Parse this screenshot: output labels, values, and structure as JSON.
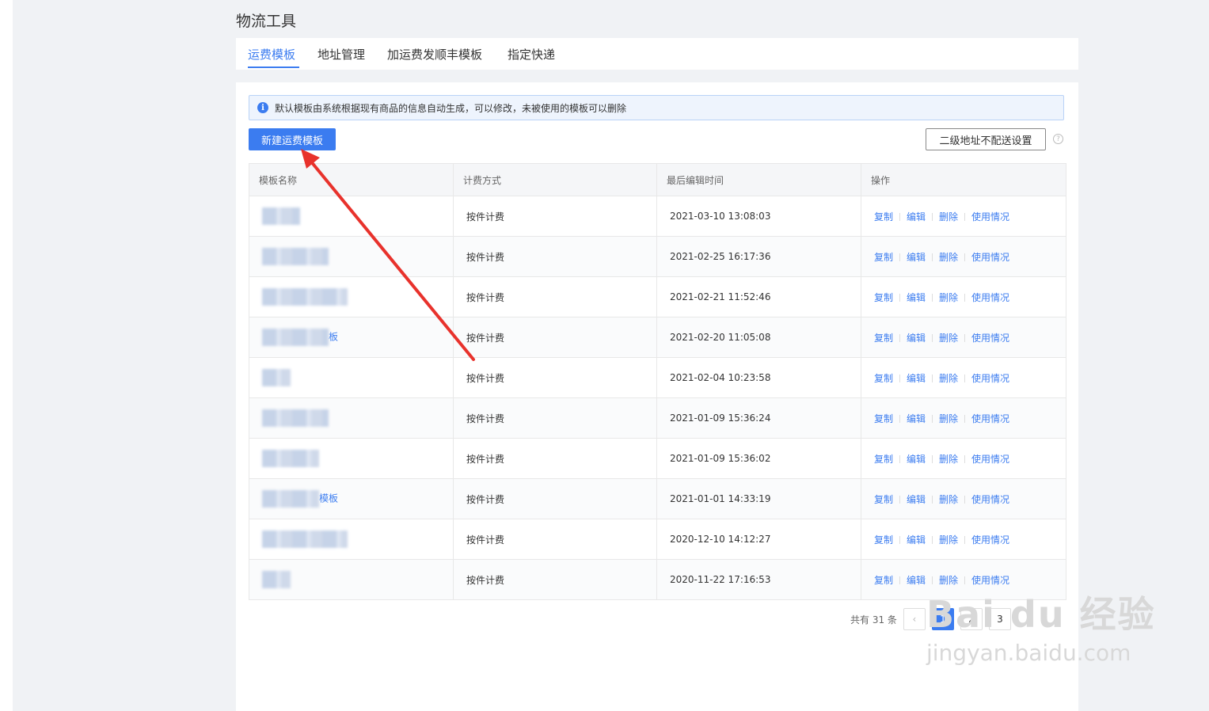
{
  "page": {
    "title": "物流工具"
  },
  "tabs": [
    {
      "label": "运费模板",
      "active": true
    },
    {
      "label": "地址管理",
      "active": false
    },
    {
      "label": "加运费发顺丰模板",
      "active": false
    },
    {
      "label": "指定快递",
      "active": false
    }
  ],
  "notice": {
    "text": "默认模板由系统根据现有商品的信息自动生成，可以修改，未被使用的模板可以删除",
    "icon": "info-icon"
  },
  "toolbar": {
    "new_button": "新建运费模板",
    "secondary_button": "二级地址不配送设置",
    "help": "?"
  },
  "table": {
    "headers": [
      "模板名称",
      "计费方式",
      "最后编辑时间",
      "操作"
    ],
    "actions": [
      "复制",
      "编辑",
      "删除",
      "使用情况"
    ],
    "rows": [
      {
        "name": "",
        "billing": "按件计费",
        "time": "2021-03-10 13:08:03"
      },
      {
        "name": "",
        "billing": "按件计费",
        "time": "2021-02-25 16:17:36"
      },
      {
        "name": "",
        "billing": "按件计费",
        "time": "2021-02-21 11:52:46"
      },
      {
        "name": "板",
        "billing": "按件计费",
        "time": "2021-02-20 11:05:08"
      },
      {
        "name": "",
        "billing": "按件计费",
        "time": "2021-02-04 10:23:58"
      },
      {
        "name": "",
        "billing": "按件计费",
        "time": "2021-01-09 15:36:24"
      },
      {
        "name": "",
        "billing": "按件计费",
        "time": "2021-01-09 15:36:02"
      },
      {
        "name": "模板",
        "billing": "按件计费",
        "time": "2021-01-01 14:33:19"
      },
      {
        "name": "",
        "billing": "按件计费",
        "time": "2020-12-10 14:12:27"
      },
      {
        "name": "",
        "billing": "按件计费",
        "time": "2020-11-22 17:16:53"
      }
    ]
  },
  "pagination": {
    "total": "共有 31 条",
    "prev": "‹",
    "pages": [
      "1",
      "2",
      "3"
    ],
    "current": "1"
  },
  "watermark": {
    "main": "Bai du 经验",
    "sub": "jingyan.baidu.com"
  },
  "colors": {
    "accent": "#3b7cf0",
    "arrow": "#e8322c"
  }
}
